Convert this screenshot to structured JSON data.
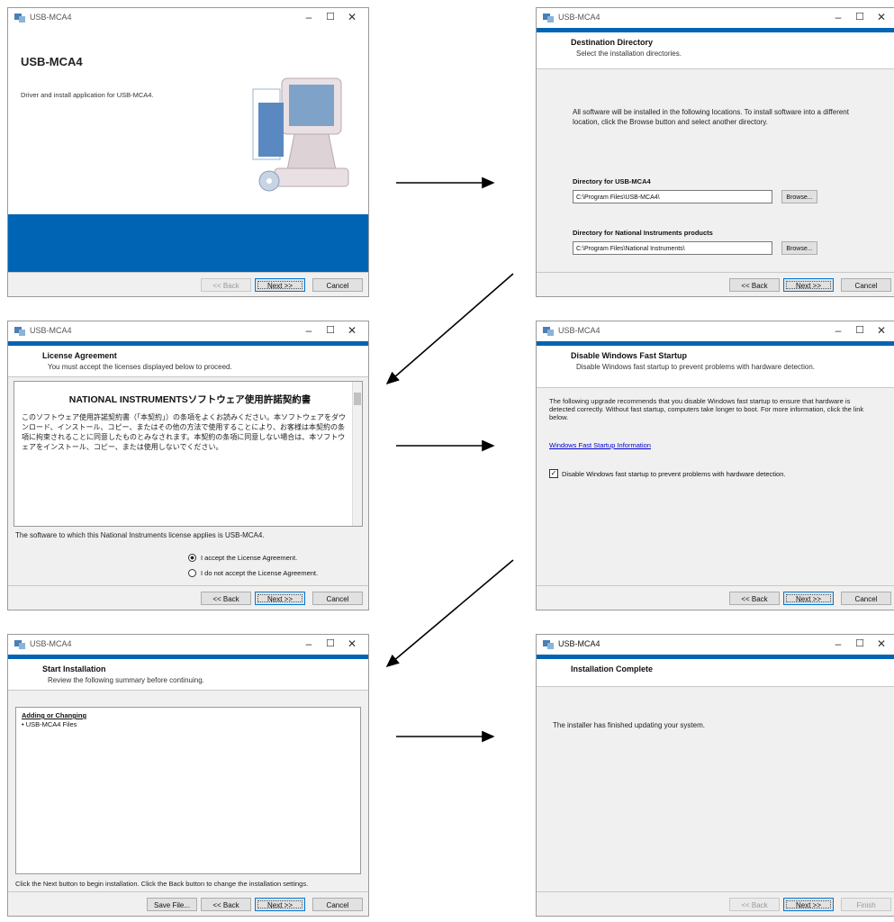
{
  "app_title": "USB-MCA4",
  "window_controls": {
    "minimize": "–",
    "maximize": "☐",
    "close": "✕"
  },
  "buttons": {
    "back": "<< Back",
    "next": "Next >>",
    "cancel": "Cancel",
    "finish": "Finish",
    "browse": "Browse...",
    "save_file": "Save File..."
  },
  "welcome": {
    "heading": "USB-MCA4",
    "text": "Driver and install application for USB-MCA4."
  },
  "destination": {
    "title": "Destination Directory",
    "subtitle": "Select the installation directories.",
    "intro": "All software will be installed in the following locations. To install software into a different location, click the Browse button and select another directory.",
    "dir1_label": "Directory for USB-MCA4",
    "dir1_value": "C:\\Program Files\\USB-MCA4\\",
    "dir2_label": "Directory for National Instruments products",
    "dir2_value": "C:\\Program Files\\National Instruments\\"
  },
  "license": {
    "title": "License Agreement",
    "subtitle": "You must accept the licenses displayed below to proceed.",
    "doc_title": "NATIONAL INSTRUMENTSソフトウェア使用許諾契約書",
    "doc_body": "このソフトウェア使用許諾契約書（「本契約」）の条項をよくお読みください。本ソフトウェアをダウンロード、インストール、コピー、またはその他の方法で使用することにより、お客様は本契約の条項に拘束されることに同意したものとみなされます。本契約の条項に同意しない場合は、本ソフトウェアをインストール、コピー、または使用しないでください。",
    "bottom_text": "The software to which this National Instruments license applies is USB-MCA4.",
    "accept": "I accept the License Agreement.",
    "decline": "I do not accept the License Agreement."
  },
  "fast_startup": {
    "title": "Disable Windows Fast Startup",
    "subtitle": "Disable Windows fast startup to prevent problems with hardware detection.",
    "body": "The following upgrade recommends that you disable Windows fast startup to ensure that hardware is detected correctly. Without fast startup, computers take longer to boot. For more information, click the link below.",
    "link": "Windows Fast Startup Information",
    "checkbox": "Disable Windows fast startup to prevent problems with hardware detection."
  },
  "start": {
    "title": "Start Installation",
    "subtitle": "Review the following summary before continuing.",
    "summary_heading": "Adding or Changing",
    "summary_item": "• USB-MCA4 Files",
    "bottom_text": "Click the Next button to begin installation. Click the Back button to change the installation settings."
  },
  "complete": {
    "title": "Installation Complete",
    "body": "The installer has finished updating your system."
  },
  "colors": {
    "accent": "#0064b4",
    "link": "#0000cc"
  }
}
